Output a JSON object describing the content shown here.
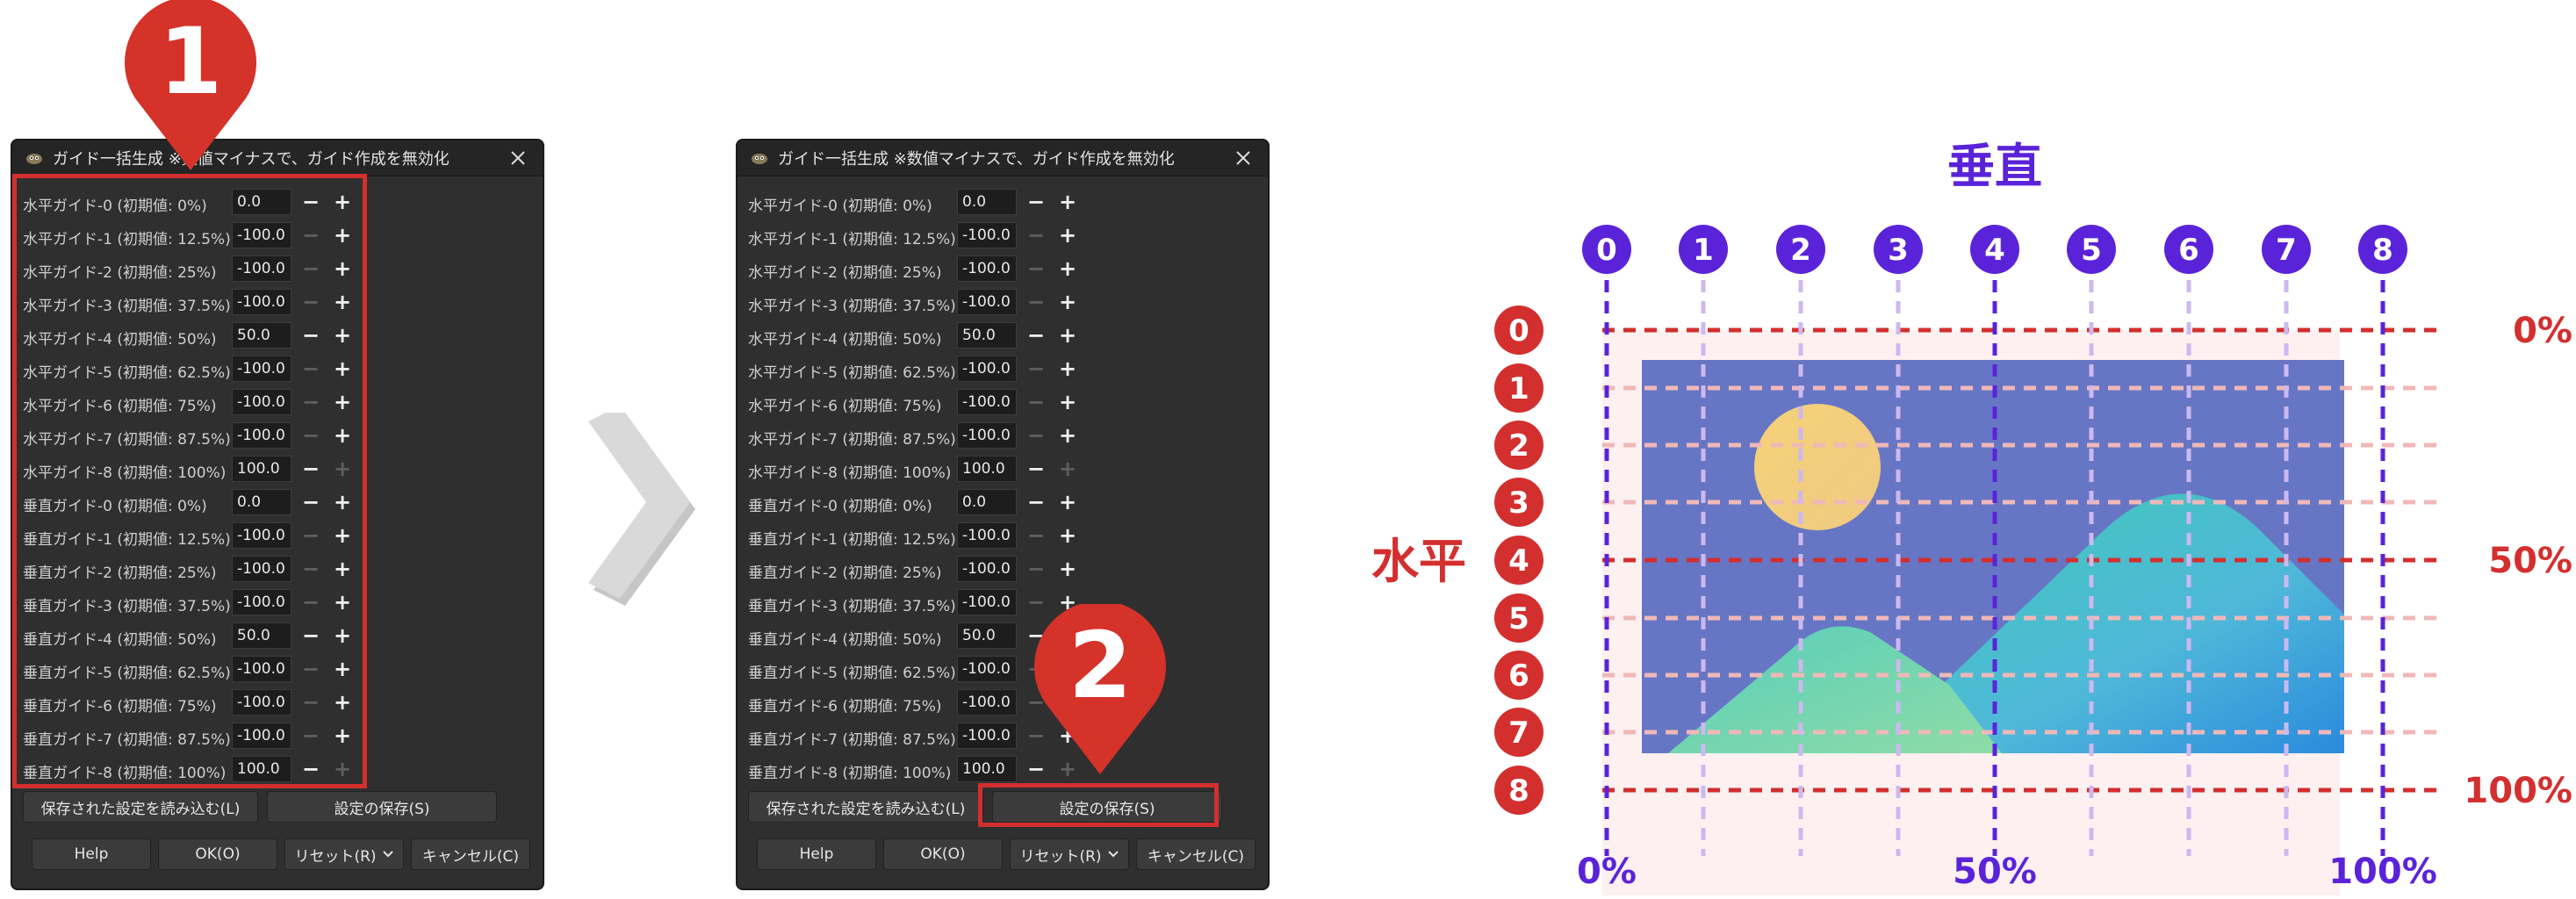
{
  "dialog_before": {
    "title": "ガイド一括生成 ※数値マイナスで、ガイド作成を無効化",
    "rows": [
      {
        "label": "水平ガイド-0 (初期値: 0%)",
        "value": "0.0",
        "minus": true,
        "plus": true
      },
      {
        "label": "水平ガイド-1 (初期値: 12.5%)",
        "value": "-100.0",
        "minus": false,
        "plus": true
      },
      {
        "label": "水平ガイド-2 (初期値: 25%)",
        "value": "-100.0",
        "minus": false,
        "plus": true
      },
      {
        "label": "水平ガイド-3 (初期値: 37.5%)",
        "value": "-100.0",
        "minus": false,
        "plus": true
      },
      {
        "label": "水平ガイド-4 (初期値: 50%)",
        "value": "50.0",
        "minus": true,
        "plus": true
      },
      {
        "label": "水平ガイド-5 (初期値: 62.5%)",
        "value": "-100.0",
        "minus": false,
        "plus": true
      },
      {
        "label": "水平ガイド-6 (初期値: 75%)",
        "value": "-100.0",
        "minus": false,
        "plus": true
      },
      {
        "label": "水平ガイド-7 (初期値: 87.5%)",
        "value": "-100.0",
        "minus": false,
        "plus": true
      },
      {
        "label": "水平ガイド-8 (初期値: 100%)",
        "value": "100.0",
        "minus": true,
        "plus": false
      },
      {
        "label": "垂直ガイド-0 (初期値: 0%)",
        "value": "0.0",
        "minus": true,
        "plus": true
      },
      {
        "label": "垂直ガイド-1 (初期値: 12.5%)",
        "value": "-100.0",
        "minus": false,
        "plus": true
      },
      {
        "label": "垂直ガイド-2 (初期値: 25%)",
        "value": "-100.0",
        "minus": false,
        "plus": true
      },
      {
        "label": "垂直ガイド-3 (初期値: 37.5%)",
        "value": "-100.0",
        "minus": false,
        "plus": true
      },
      {
        "label": "垂直ガイド-4 (初期値: 50%)",
        "value": "50.0",
        "minus": true,
        "plus": true
      },
      {
        "label": "垂直ガイド-5 (初期値: 62.5%)",
        "value": "-100.0",
        "minus": false,
        "plus": true
      },
      {
        "label": "垂直ガイド-6 (初期値: 75%)",
        "value": "-100.0",
        "minus": false,
        "plus": true
      },
      {
        "label": "垂直ガイド-7 (初期値: 87.5%)",
        "value": "-100.0",
        "minus": false,
        "plus": true
      },
      {
        "label": "垂直ガイド-8 (初期値: 100%)",
        "value": "100.0",
        "minus": true,
        "plus": false
      }
    ]
  },
  "dialog_after": {
    "title": "ガイド一括生成 ※数値マイナスで、ガイド作成を無効化",
    "rows": [
      {
        "label": "水平ガイド-0 (初期値: 0%)",
        "value": "0.0",
        "minus": true,
        "plus": true
      },
      {
        "label": "水平ガイド-1 (初期値: 12.5%)",
        "value": "-100.0",
        "minus": false,
        "plus": true
      },
      {
        "label": "水平ガイド-2 (初期値: 25%)",
        "value": "-100.0",
        "minus": false,
        "plus": true
      },
      {
        "label": "水平ガイド-3 (初期値: 37.5%)",
        "value": "-100.0",
        "minus": false,
        "plus": true
      },
      {
        "label": "水平ガイド-4 (初期値: 50%)",
        "value": "50.0",
        "minus": true,
        "plus": true
      },
      {
        "label": "水平ガイド-5 (初期値: 62.5%)",
        "value": "-100.0",
        "minus": false,
        "plus": true
      },
      {
        "label": "水平ガイド-6 (初期値: 75%)",
        "value": "-100.0",
        "minus": false,
        "plus": true
      },
      {
        "label": "水平ガイド-7 (初期値: 87.5%)",
        "value": "-100.0",
        "minus": false,
        "plus": true
      },
      {
        "label": "水平ガイド-8 (初期値: 100%)",
        "value": "100.0",
        "minus": true,
        "plus": false
      },
      {
        "label": "垂直ガイド-0 (初期値: 0%)",
        "value": "0.0",
        "minus": true,
        "plus": true
      },
      {
        "label": "垂直ガイド-1 (初期値: 12.5%)",
        "value": "-100.0",
        "minus": false,
        "plus": true
      },
      {
        "label": "垂直ガイド-2 (初期値: 25%)",
        "value": "-100.0",
        "minus": false,
        "plus": true
      },
      {
        "label": "垂直ガイド-3 (初期値: 37.5%)",
        "value": "-100.0",
        "minus": false,
        "plus": true
      },
      {
        "label": "垂直ガイド-4 (初期値: 50%)",
        "value": "50.0",
        "minus": true,
        "plus": true
      },
      {
        "label": "垂直ガイド-5 (初期値: 62.5%)",
        "value": "-100.0",
        "minus": false,
        "plus": true
      },
      {
        "label": "垂直ガイド-6 (初期値: 75%)",
        "value": "-100.0",
        "minus": false,
        "plus": true
      },
      {
        "label": "垂直ガイド-7 (初期値: 87.5%)",
        "value": "-100.0",
        "minus": false,
        "plus": true
      },
      {
        "label": "垂直ガイド-8 (初期値: 100%)",
        "value": "100.0",
        "minus": true,
        "plus": false
      }
    ]
  },
  "buttons": {
    "load": "保存された設定を読み込む(L)",
    "save": "設定の保存(S)",
    "help": "Help",
    "ok": "OK(O)",
    "reset": "リセット(R)",
    "cancel": "キャンセル(C)"
  },
  "callouts": {
    "first": "1",
    "second": "2"
  },
  "diagram": {
    "vertical_title": "垂直",
    "horizontal_title": "水平",
    "column_numbers": [
      "0",
      "1",
      "2",
      "3",
      "4",
      "5",
      "6",
      "7",
      "8"
    ],
    "row_numbers": [
      "0",
      "1",
      "2",
      "3",
      "4",
      "5",
      "6",
      "7",
      "8"
    ],
    "right_percent_labels": [
      "0%",
      "50%",
      "100%"
    ],
    "bottom_percent_labels": [
      "0%",
      "50%",
      "100%"
    ],
    "colors": {
      "vertical": "#5b23d9",
      "horizontal": "#d32f2f",
      "image_sky": "#6676c4",
      "sun": "#f2cf7e",
      "mountain": "#3fc7b8"
    }
  },
  "icons": {
    "app": "wilber-icon",
    "close": "close-icon",
    "arrow": "chevron-right-icon",
    "chevron": "chevron-down-icon"
  }
}
